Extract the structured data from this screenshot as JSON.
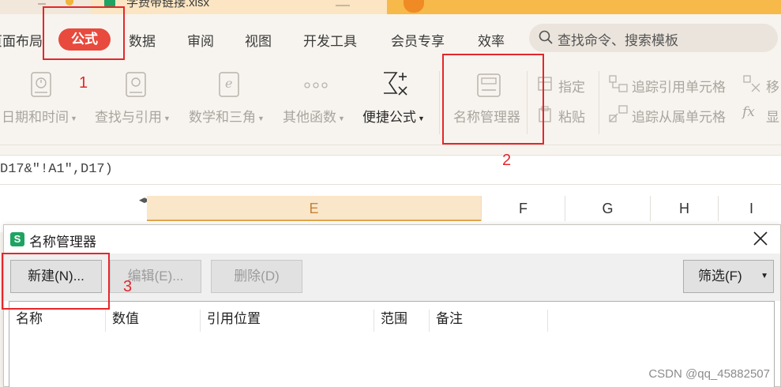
{
  "title_bar": {
    "file_name": "学费带链接.xlsx"
  },
  "menu": {
    "tabs": [
      {
        "label": "页面布局"
      },
      {
        "label": "公式"
      },
      {
        "label": "数据"
      },
      {
        "label": "审阅"
      },
      {
        "label": "视图"
      },
      {
        "label": "开发工具"
      },
      {
        "label": "会员专享"
      },
      {
        "label": "效率"
      }
    ],
    "search_placeholder": "查找命令、搜索模板"
  },
  "ribbon": {
    "datetime": "日期和时间",
    "lookup": "查找与引用",
    "math": "数学和三角",
    "other": "其他函数",
    "quick_formula": "便捷公式",
    "name_manager": "名称管理器",
    "specify": "指定",
    "paste": "粘贴",
    "trace_precedents": "追踪引用单元格",
    "trace_dependents": "追踪从属单元格",
    "move": "移",
    "show": "显"
  },
  "formula_bar": {
    "text": "D17&\"!A1\",D17)"
  },
  "grid": {
    "columns": [
      "E",
      "F",
      "G",
      "H",
      "I"
    ]
  },
  "dialog": {
    "title": "名称管理器",
    "app_icon": "S",
    "buttons": {
      "new": "新建(N)...",
      "edit": "编辑(E)...",
      "delete": "删除(D)",
      "filter": "筛选(F)"
    },
    "columns": [
      "名称",
      "数值",
      "引用位置",
      "范围",
      "备注"
    ]
  },
  "annotations": {
    "n1": "1",
    "n2": "2",
    "n3": "3",
    "color": "#e5262b"
  },
  "watermark": "CSDN @qq_45882507",
  "colors": {
    "accent_red": "#e84a3d",
    "wps_green": "#1fa362",
    "tab_orange": "#f7b949"
  }
}
